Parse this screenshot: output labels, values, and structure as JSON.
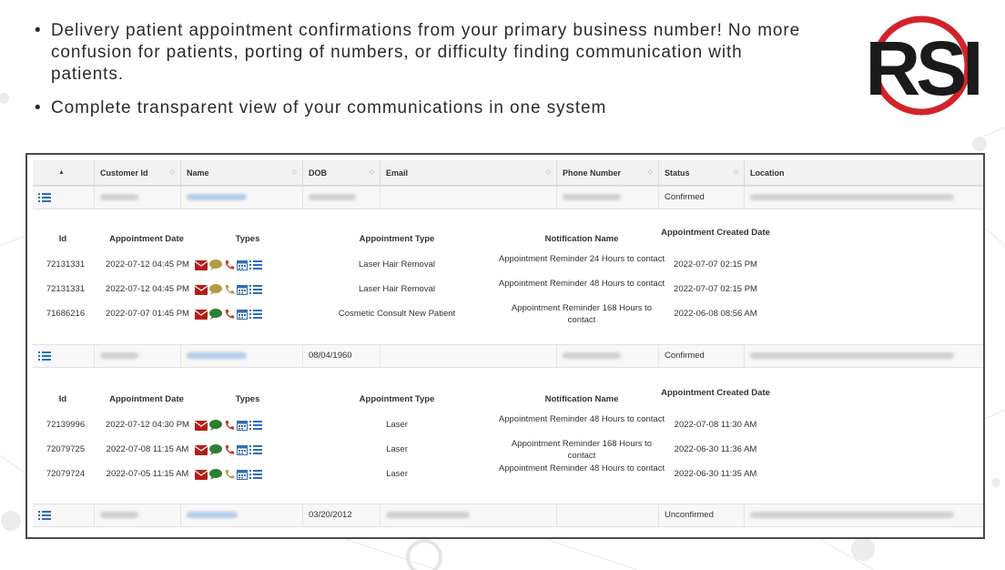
{
  "bullets": [
    {
      "dot": "•",
      "text": "Delivery patient appointment confirmations from your primary business number! No more confusion for patients, porting of numbers, or difficulty finding communication with patients."
    },
    {
      "dot": "•",
      "text": "Complete transparent view of your communications in one system"
    }
  ],
  "logo": {
    "text": "RSI",
    "ring_color": "#d2232a",
    "text_color": "#1a1a1a"
  },
  "grid": {
    "columns": [
      {
        "label": ""
      },
      {
        "label": "Customer Id"
      },
      {
        "label": "Name"
      },
      {
        "label": "DOB"
      },
      {
        "label": "Email"
      },
      {
        "label": "Phone Number"
      },
      {
        "label": "Status"
      },
      {
        "label": "Location"
      }
    ],
    "rows": [
      {
        "dob": "",
        "status": "Confirmed"
      },
      {
        "dob": "08/04/1960",
        "status": "Confirmed"
      },
      {
        "dob": "03/20/2012",
        "status": "Unconfirmed"
      }
    ]
  },
  "sub_headers": {
    "id": "Id",
    "appointment_date": "Appointment Date",
    "types": "Types",
    "appointment_type": "Appointment Type",
    "notification_name": "Notification Name",
    "created_date": "Appointment Created Date"
  },
  "sub_tables": [
    {
      "rows": [
        {
          "id": "72131331",
          "date": "2022-07-12 04:45 PM",
          "type": "Laser Hair Removal",
          "notification": "Appointment Reminder 24 Hours to contact",
          "created": "2022-07-07 02:15 PM",
          "chat_color": "#b59a4a",
          "phone_color": "#c0392b"
        },
        {
          "id": "72131331",
          "date": "2022-07-12 04:45 PM",
          "type": "Laser Hair Removal",
          "notification": "Appointment Reminder 48 Hours to contact",
          "created": "2022-07-07 02:15 PM",
          "chat_color": "#b59a4a",
          "phone_color": "#b59a4a"
        },
        {
          "id": "71686216",
          "date": "2022-07-07 01:45 PM",
          "type": "Cosmetic Consult New Patient",
          "notification": "Appointment Reminder 168 Hours to contact",
          "created": "2022-06-08 08:56 AM",
          "chat_color": "#2e7d32",
          "phone_color": "#c0392b"
        }
      ]
    },
    {
      "rows": [
        {
          "id": "72139996",
          "date": "2022-07-12 04:30 PM",
          "type": "Laser",
          "notification": "Appointment Reminder 48 Hours to contact",
          "created": "2022-07-08 11:30 AM",
          "chat_color": "#2e7d32",
          "phone_color": "#c0392b"
        },
        {
          "id": "72079725",
          "date": "2022-07-08 11:15 AM",
          "type": "Laser",
          "notification": "Appointment Reminder 168 Hours to contact",
          "created": "2022-06-30 11:36 AM",
          "chat_color": "#2e7d32",
          "phone_color": "#c0392b"
        },
        {
          "id": "72079724",
          "date": "2022-07-05 11:15 AM",
          "type": "Laser",
          "notification": "Appointment Reminder 48 Hours to contact",
          "created": "2022-06-30 11:35 AM",
          "chat_color": "#2e7d32",
          "phone_color": "#b59a4a"
        }
      ]
    }
  ],
  "icons": {
    "list": "list-icon",
    "email": "envelope-icon",
    "chat": "chat-bubble-icon",
    "phone": "phone-icon",
    "calendar": "calendar-icon",
    "details": "list-icon",
    "sort": "sort-icon"
  },
  "colors": {
    "email": "#b71c1c",
    "calendar": "#2f6fb3",
    "list": "#2f6fb3",
    "border": "#4a4a4a",
    "header_bg": "#f2f2f2"
  }
}
